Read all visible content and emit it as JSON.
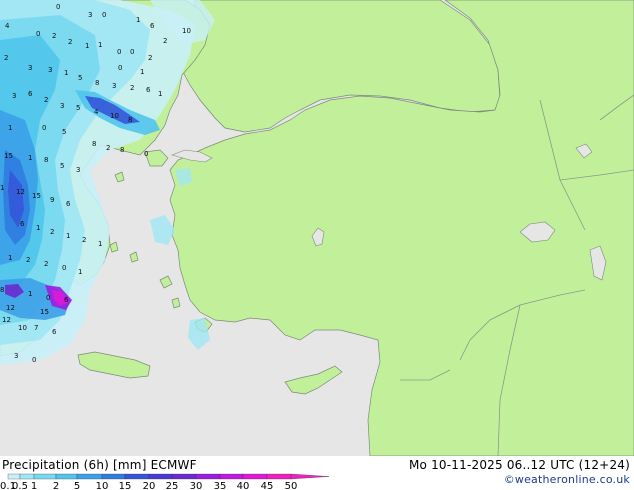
{
  "title": "Precipitation (6h) [mm] ECMWF",
  "datetime": "Mo 10-11-2025 06..12 UTC (12+24)",
  "credit": "©weatheronline.co.uk",
  "legend": {
    "labels": [
      "0.1",
      "0.5",
      "1",
      "2",
      "5",
      "10",
      "15",
      "20",
      "25",
      "30",
      "35",
      "40",
      "45",
      "50"
    ],
    "colors": [
      "#c8f0f8",
      "#a0e6f4",
      "#78d8f0",
      "#50c4ec",
      "#3ca0e8",
      "#2f7ce0",
      "#3556d8",
      "#4a3ad0",
      "#6a2ad0",
      "#9a1ee0",
      "#c01ae0",
      "#e018d8",
      "#f020c0"
    ]
  },
  "map": {
    "colors": {
      "sea": "#e6e6e6",
      "land": "#c2f09a",
      "border": "#8a9a8a",
      "coast": "#7a8a7a"
    },
    "station_values": [
      "4",
      "0",
      "3",
      "0",
      "1",
      "6",
      "10",
      "2",
      "0",
      "2",
      "1",
      "0",
      "0",
      "2",
      "2",
      "1",
      "3",
      "1",
      "5",
      "2",
      "3",
      "8",
      "3",
      "2",
      "6",
      "0",
      "1",
      "1",
      "4",
      "10",
      "8",
      "3",
      "6",
      "2",
      "3",
      "5",
      "1",
      "0",
      "5",
      "8",
      "2",
      "8",
      "0",
      "15",
      "1",
      "8",
      "5",
      "3",
      "1",
      "12",
      "15",
      "9",
      "6",
      "6",
      "1",
      "2",
      "1",
      "2",
      "1",
      "1",
      "2",
      "2",
      "0",
      "1",
      "8",
      "1",
      "0",
      "6",
      "12",
      "15",
      "12",
      "10",
      "7",
      "6",
      "3",
      "0"
    ]
  }
}
